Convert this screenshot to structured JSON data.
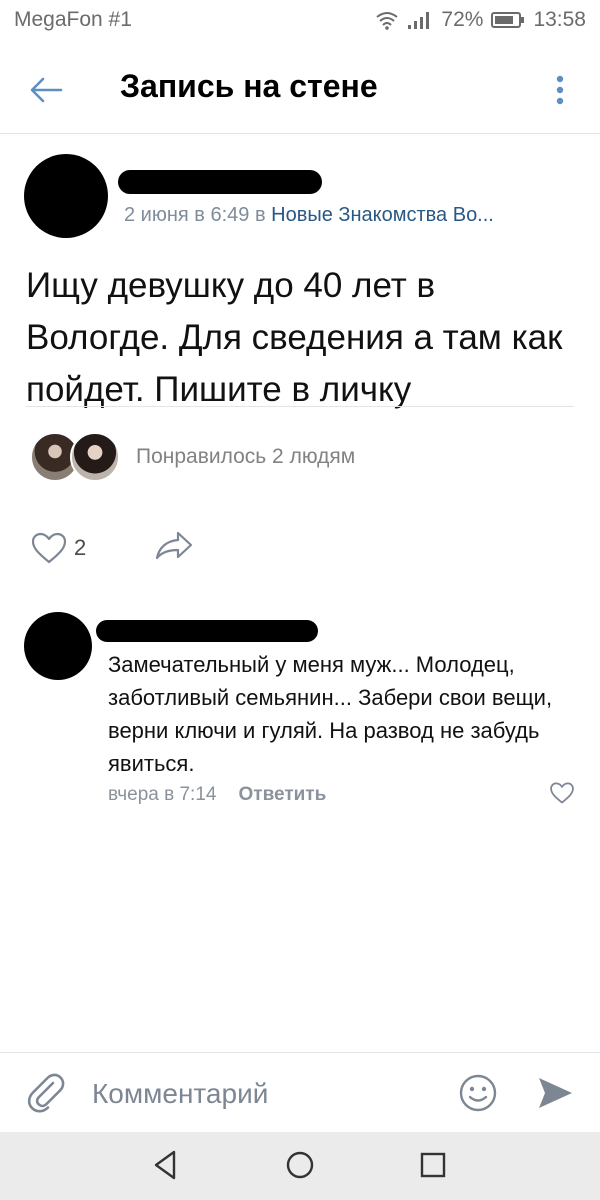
{
  "status_bar": {
    "carrier": "MegaFon #1",
    "battery": "72%",
    "time": "13:58"
  },
  "header": {
    "title": "Запись на стене",
    "back_icon": "arrow-left-icon",
    "more_icon": "more-vertical-icon"
  },
  "post": {
    "meta": "2 июня в 6:49 в",
    "group": "Новые Знакомства Во...",
    "text": "Ищу девушку до 40 лет в Вологде. Для сведения а там как пойдет. Пишите в личку",
    "likers_text": "Понравилось 2 людям",
    "like_count": "2"
  },
  "comment": {
    "text": "Замечательный у меня муж... Молодец, заботливый семьянин... Забери свои вещи, верни ключи и гуляй. На развод не забудь явиться.",
    "time": "вчера в 7:14",
    "reply_label": "Ответить"
  },
  "input": {
    "placeholder": "Комментарий"
  },
  "colors": {
    "accent": "#2a5885",
    "icon": "#5d8fc2",
    "meta": "#7f8c99"
  }
}
